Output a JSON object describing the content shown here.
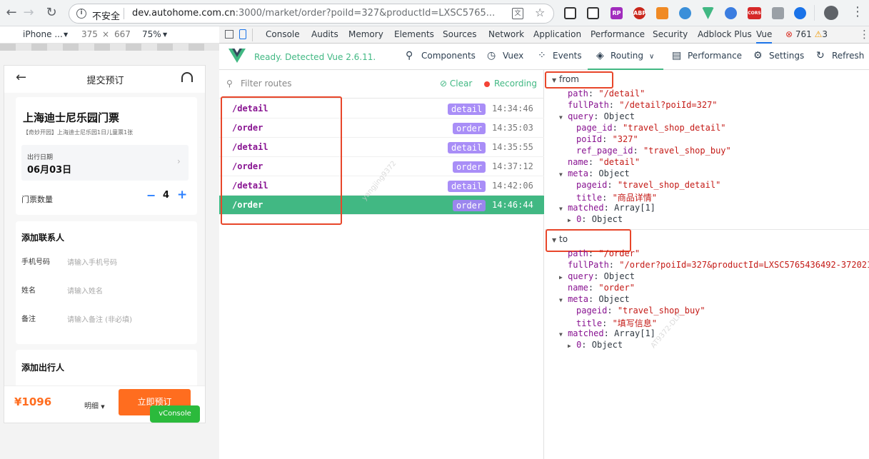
{
  "browser": {
    "secure_label": "不安全",
    "url_host": "dev.autohome.com.cn",
    "url_rest": ":3000/market/order?poiId=327&productId=LXSC5765...",
    "extensions": [
      "qr-icon",
      "capture-icon",
      "rp-icon",
      "abp-icon",
      "c-icon",
      "globe-icon",
      "vue-icon",
      "edge-icon",
      "cors-icon",
      "puzzle-icon",
      "refresh-ext-icon"
    ],
    "ext_labels": {
      "rp": "RP",
      "abp": "ABP",
      "cors": "CORS"
    }
  },
  "device": {
    "model": "iPhone ...",
    "width": "375",
    "x": "×",
    "height": "667",
    "zoom": "75%"
  },
  "devtools": {
    "tabs": [
      "Console",
      "Audits",
      "Memory",
      "Elements",
      "Sources",
      "Network",
      "Application",
      "Performance",
      "Security",
      "Adblock Plus",
      "Vue"
    ],
    "errors": "761",
    "warnings": "3"
  },
  "vue": {
    "status": "Ready. Detected Vue 2.6.11.",
    "nav": {
      "components": "Components",
      "vuex": "Vuex",
      "events": "Events",
      "routing": "Routing",
      "performance": "Performance",
      "settings": "Settings",
      "refresh": "Refresh"
    },
    "filter_placeholder": "Filter routes",
    "clear": "Clear",
    "recording": "Recording",
    "routes": [
      {
        "path": "/detail",
        "name": "detail",
        "time": "14:34:46"
      },
      {
        "path": "/order",
        "name": "order",
        "time": "14:35:03"
      },
      {
        "path": "/detail",
        "name": "detail",
        "time": "14:35:55"
      },
      {
        "path": "/order",
        "name": "order",
        "time": "14:37:12"
      },
      {
        "path": "/detail",
        "name": "detail",
        "time": "14:42:06"
      },
      {
        "path": "/order",
        "name": "order",
        "time": "14:46:44"
      }
    ]
  },
  "inspector": {
    "from": {
      "label": "from",
      "path": "\"/detail\"",
      "fullPath": "\"/detail?poiId=327\"",
      "query_type": "Object",
      "page_id": "\"travel_shop_detail\"",
      "poiId": "\"327\"",
      "ref_page_id": "\"travel_shop_buy\"",
      "name": "\"detail\"",
      "meta_type": "Object",
      "pageid": "\"travel_shop_detail\"",
      "title": "\"商品详情\"",
      "matched_type": "Array[1]",
      "matched_0": "Object"
    },
    "to": {
      "label": "to",
      "path": "\"/order\"",
      "fullPath": "\"/order?poiId=327&productId=LXSC5765436492-372021",
      "query_type": "Object",
      "name": "\"order\"",
      "meta_type": "Object",
      "pageid": "\"travel_shop_buy\"",
      "title": "\"填写信息\"",
      "matched_type": "Array[1]",
      "matched_0": "Object"
    },
    "keys": {
      "path": "path",
      "fullPath": "fullPath",
      "query": "query",
      "page_id": "page_id",
      "poiId": "poiId",
      "ref_page_id": "ref_page_id",
      "name": "name",
      "meta": "meta",
      "pageid": "pageid",
      "title": "title",
      "matched": "matched",
      "zero": "0"
    }
  },
  "phone": {
    "page_title": "提交预订",
    "product_title": "上海迪士尼乐园门票",
    "product_sub": "【奇妙开园】上海迪士尼乐园1日儿童票1张",
    "date_label": "出行日期",
    "date_value": "06月03日",
    "qty_label": "门票数量",
    "qty_value": "4",
    "minus": "−",
    "plus": "+",
    "contact_title": "添加联系人",
    "phone_label": "手机号码",
    "phone_ph": "请输入手机号码",
    "name_label": "姓名",
    "name_ph": "请输入姓名",
    "note_label": "备注",
    "note_ph": "请输入备注 (非必填)",
    "traveler_title": "添加出行人",
    "price": "¥1096",
    "detail": "明细",
    "submit": "立即预订",
    "vconsole": "vConsole"
  },
  "watermarks": [
    "yangjing9372",
    "AT9372-DLP"
  ],
  "colors": {
    "vue_green": "#41b883",
    "route_tag": "#a98ef7",
    "orange": "#ff6d1f",
    "annotation_red": "#e8462a",
    "vconsole_green": "#2bba3c",
    "link_blue": "#2a7fff"
  }
}
